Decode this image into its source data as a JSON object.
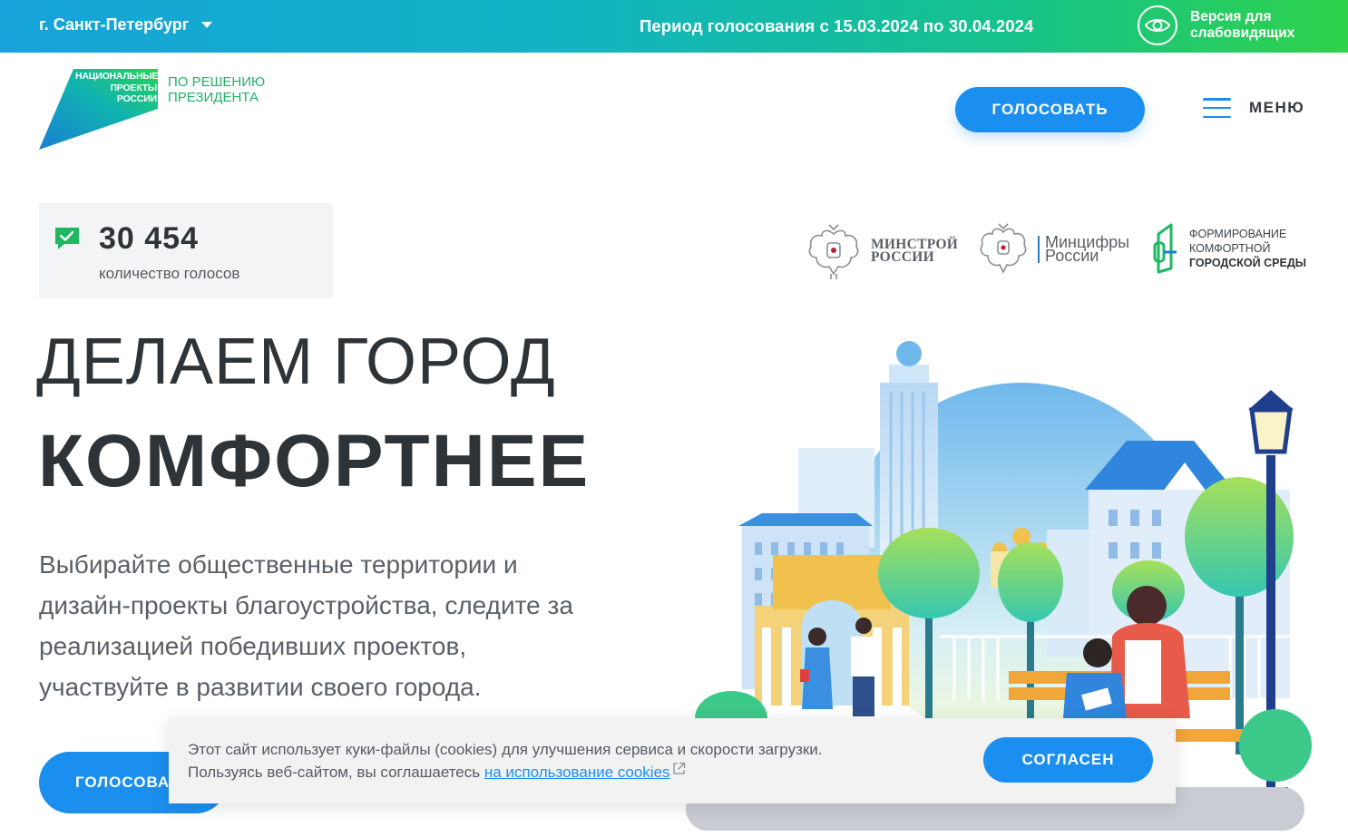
{
  "topbar": {
    "city": "г. Санкт-Петербург",
    "period": "Период голосования с 15.03.2024 по 30.04.2024",
    "vision_line1": "Версия для",
    "vision_line2": "слабовидящих"
  },
  "logo": {
    "tri_line1": "НАЦИОНАЛЬНЫЕ",
    "tri_line2": "ПРОЕКТЫ",
    "tri_line3": "РОССИИ",
    "slogan_line1": "ПО РЕШЕНИЮ",
    "slogan_line2": "ПРЕЗИДЕНТА"
  },
  "header": {
    "vote_label": "ГОЛОСОВАТЬ",
    "menu_label": "МЕНЮ"
  },
  "counter": {
    "value": "30 454",
    "caption": "количество голосов"
  },
  "partners": {
    "minstroy_line1": "МИНСТРОЙ",
    "minstroy_line2": "РОССИИ",
    "mincifry_line1": "Минцифры",
    "mincifry_line2": "России",
    "fkgs_line1": "ФОРМИРОВАНИЕ",
    "fkgs_line2": "КОМФОРТНОЙ",
    "fkgs_line3": "ГОРОДСКОЙ СРЕДЫ"
  },
  "hero": {
    "title_line1": "ДЕЛАЕМ ГОРОД",
    "title_line2": "КОМФОРТНЕЕ",
    "lead_line1": "Выбирайте общественные территории и",
    "lead_line2": "дизайн-проекты благоустройства, следите за",
    "lead_line3": "реализацией победивших проектов,",
    "lead_line4": "участвуйте в развитии своего города.",
    "vote_label": "ГОЛОСОВАТЬ"
  },
  "cookie": {
    "line1": "Этот сайт использует куки-файлы (cookies) для улучшения сервиса и скорости загрузки.",
    "line2_prefix": "Пользуясь веб-сайтом, вы соглашаетесь",
    "link_text": "на использование cookies",
    "agree_label": "СОГЛАСЕН"
  },
  "colors": {
    "accent": "#1b8ff0",
    "green": "#20b06a",
    "topbar_start": "#17a3d9",
    "topbar_end": "#2fd24a"
  },
  "icons": {
    "city_dropdown": "chevron-down-icon",
    "vision": "eye-icon",
    "menu": "hamburger-icon",
    "votes": "checkmark-message-icon",
    "external_link": "external-link-icon"
  }
}
